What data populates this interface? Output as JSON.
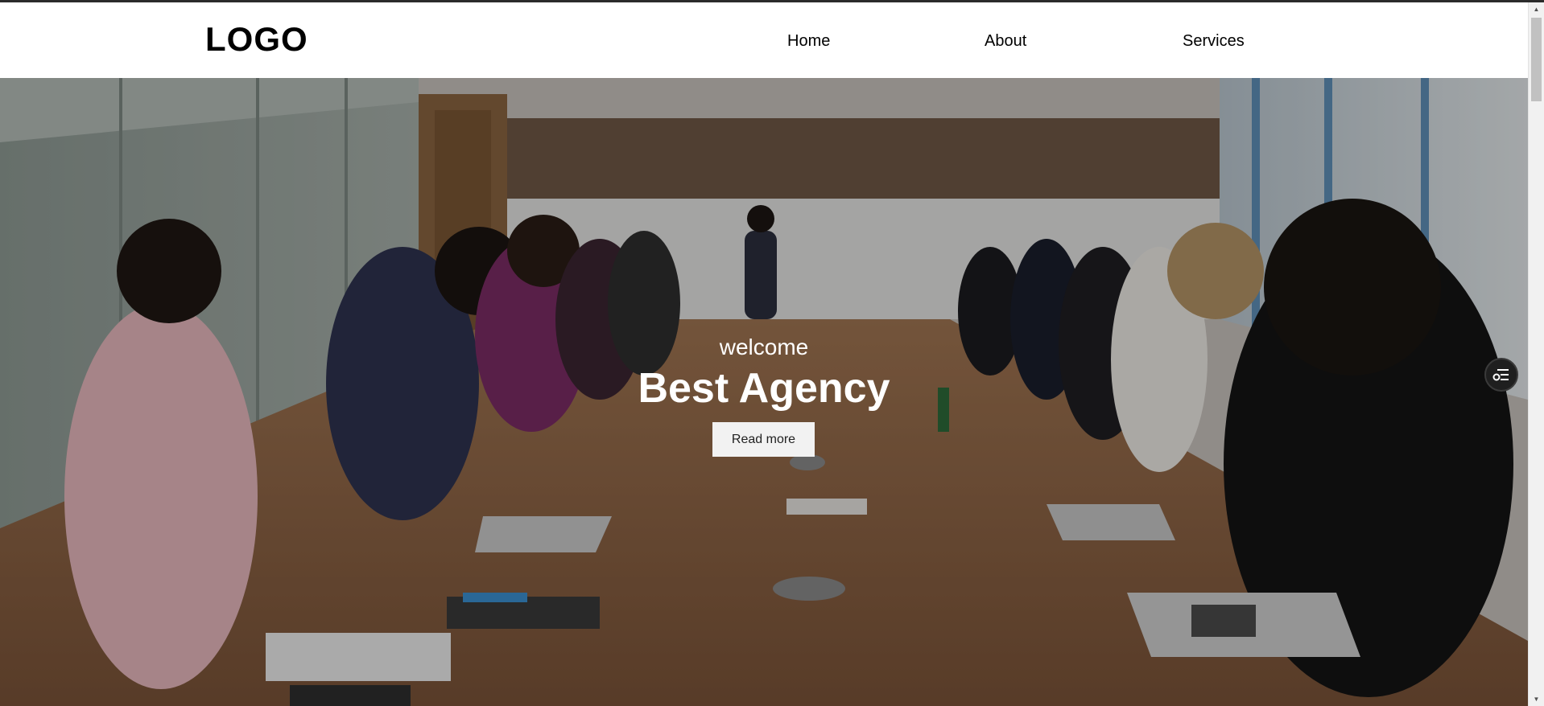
{
  "header": {
    "logo": "LOGO",
    "nav": [
      {
        "label": "Home"
      },
      {
        "label": "About"
      },
      {
        "label": "Services"
      }
    ]
  },
  "hero": {
    "welcome": "welcome",
    "title": "Best Agency",
    "button_label": "Read more",
    "background_image": "office meeting-room photo: people seated at a long wooden table with laptops, a presenter writing on a whiteboard"
  },
  "widget": {
    "icon": "menu-settings-icon"
  },
  "scrollbar": {
    "up_icon": "arrow-up-icon",
    "down_icon": "arrow-down-icon"
  },
  "colors": {
    "header_bg": "#ffffff",
    "hero_text": "#ffffff",
    "button_bg": "#f2f2f2",
    "widget_bg": "#1f1f1f"
  }
}
